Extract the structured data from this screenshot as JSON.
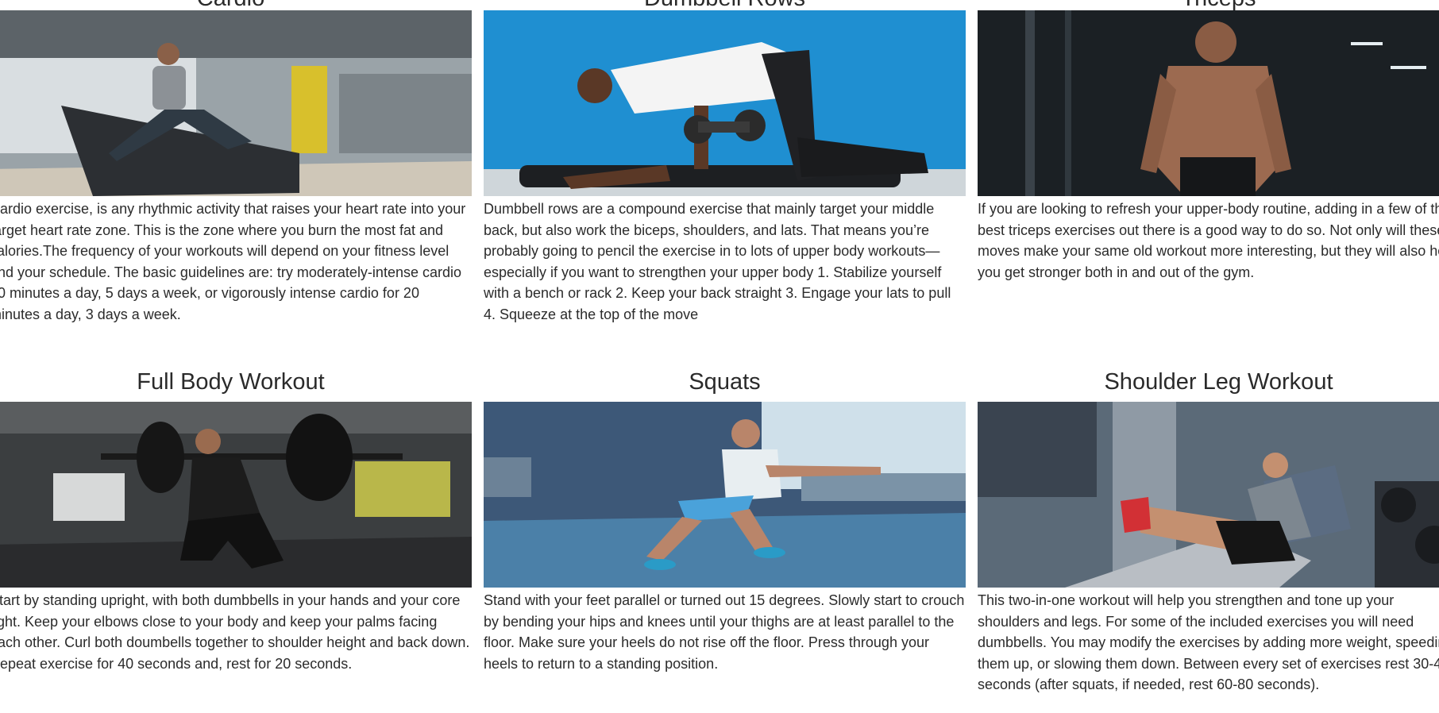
{
  "cards": [
    {
      "title": "Cardio",
      "image_alt": "Man running on a treadmill in a gym",
      "description": "Cardio exercise, is any rhythmic activity that raises your heart rate into your target heart rate zone. This is the zone where you burn the most fat and calories.The frequency of your workouts will depend on your fitness level and your schedule. The basic guidelines are: try moderately-intense cardio 30 minutes a day, 5 days a week, or vigorously intense cardio for 20 minutes a day, 3 days a week."
    },
    {
      "title": "Dumbbell Rows",
      "image_alt": "Man doing a dumbbell row on a bench",
      "description": "Dumbbell rows are a compound exercise that mainly target your middle back, but also work the biceps, shoulders, and lats. That means you’re probably going to pencil the exercise in to lots of upper body workouts—especially if you want to strengthen your upper body 1. Stabilize yourself with a bench or rack 2. Keep your back straight 3. Engage your lats to pull 4. Squeeze at the top of the move"
    },
    {
      "title": "Triceps",
      "image_alt": "Muscular man at a cable machine",
      "description": "If you are looking to refresh your upper-body routine, adding in a few of the best triceps exercises out there is a good way to do so. Not only will these moves make your same old workout more interesting, but they will also help you get stronger both in and out of the gym."
    },
    {
      "title": "Full Body Workout",
      "image_alt": "Man squatting with a barbell",
      "description": "Start by standing upright, with both dumbbells in your hands and your core tight. Keep your elbows close to your body and keep your palms facing each other. Curl both doumbells together to shoulder height and back down. Repeat exercise for 40 seconds and, rest for 20 seconds."
    },
    {
      "title": "Squats",
      "image_alt": "Man doing a bodyweight squat",
      "description": "Stand with your feet parallel or turned out 15 degrees. Slowly start to crouch by bending your hips and knees until your thighs are at least parallel to the floor. Make sure your heels do not rise off the floor. Press through your heels to return to a standing position."
    },
    {
      "title": "Shoulder Leg Workout",
      "image_alt": "Man using a leg press machine",
      "description": "This two-in-one workout will help you strengthen and tone up your shoulders and legs. For some of the included exercises you will need dumbbells. You may modify the exercises by adding more weight, speeding them up, or slowing them down. Between every set of exercises rest 30-45 seconds (after squats, if needed, rest 60-80 seconds)."
    }
  ]
}
